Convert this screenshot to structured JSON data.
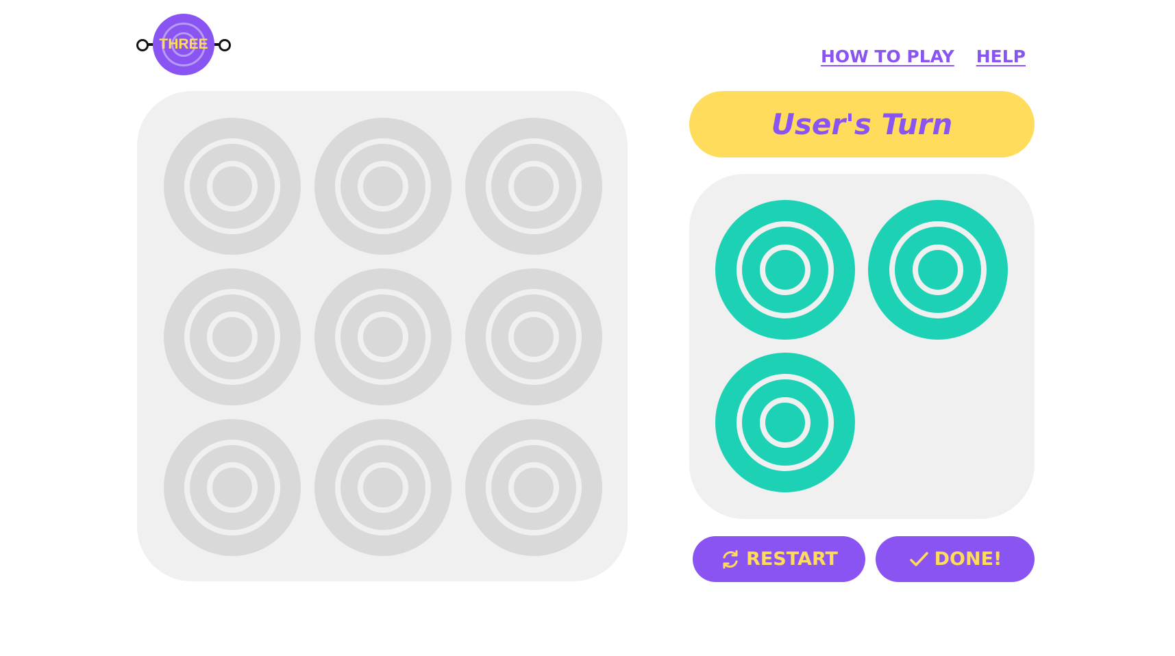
{
  "logo": {
    "text": "THREE"
  },
  "nav": {
    "how_to_play": "HOW TO PLAY",
    "help": "HELP"
  },
  "status": {
    "turn_text": "User's Turn"
  },
  "board": {
    "rows": 3,
    "cols": 3,
    "cells": [
      "empty",
      "empty",
      "empty",
      "empty",
      "empty",
      "empty",
      "empty",
      "empty",
      "empty"
    ]
  },
  "pieces": {
    "remaining": 3
  },
  "buttons": {
    "restart": {
      "label": "RESTART",
      "icon": "refresh-icon"
    },
    "done": {
      "label": "DONE!",
      "icon": "check-icon"
    }
  },
  "colors": {
    "accent_purple": "#8a54f2",
    "accent_yellow": "#ffdc5c",
    "piece_teal": "#1dd1b5",
    "empty_cell": "#d9d9d9",
    "panel_bg": "#f0f0f0"
  }
}
